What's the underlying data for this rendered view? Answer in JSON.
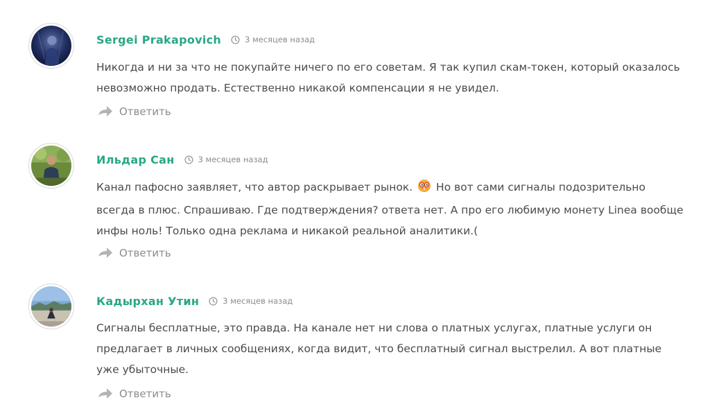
{
  "comments": [
    {
      "author": "Sergei Prakapovich",
      "time": "3 месяцев назад",
      "lines": [
        "Никогда и ни за что не покупайте ничего по его советам. Я так купил скам-токен, который оказалось",
        "невозможно продать. Естественно никакой компенсации я не увидел."
      ],
      "reply_label": "Ответить",
      "avatar_icon": "avatar-dark-photo"
    },
    {
      "author": "Ильдар Сан",
      "time": "3 месяцев назад",
      "lines": [
        "Канал пафосно заявляет, что автор раскрывает рынок.",
        "Но вот сами сигналы подозрительно",
        "всегда в плюс. Спрашиваю. Где подтверждения? ответа нет. А про его любимую монету Linea вообще",
        "инфы ноль! Только одна реклама и никакой реальной аналитики.("
      ],
      "emoji_icon": "nerd-face-emoji-icon",
      "reply_label": "Ответить",
      "avatar_icon": "avatar-green-photo"
    },
    {
      "author": "Кадырхан Утин",
      "time": "3 месяцев назад",
      "lines": [
        "Сигналы бесплатные, это правда. На канале нет ни слова о платных услугах, платные услуги он",
        "предлагает в личных сообщениях, когда видит, что бесплатный сигнал выстрелил. А вот платные",
        "уже убыточные."
      ],
      "reply_label": "Ответить",
      "avatar_icon": "avatar-landscape-photo"
    }
  ],
  "colors": {
    "author": "#29a784",
    "text": "#4a4a4a",
    "muted": "#8b8b8b"
  }
}
